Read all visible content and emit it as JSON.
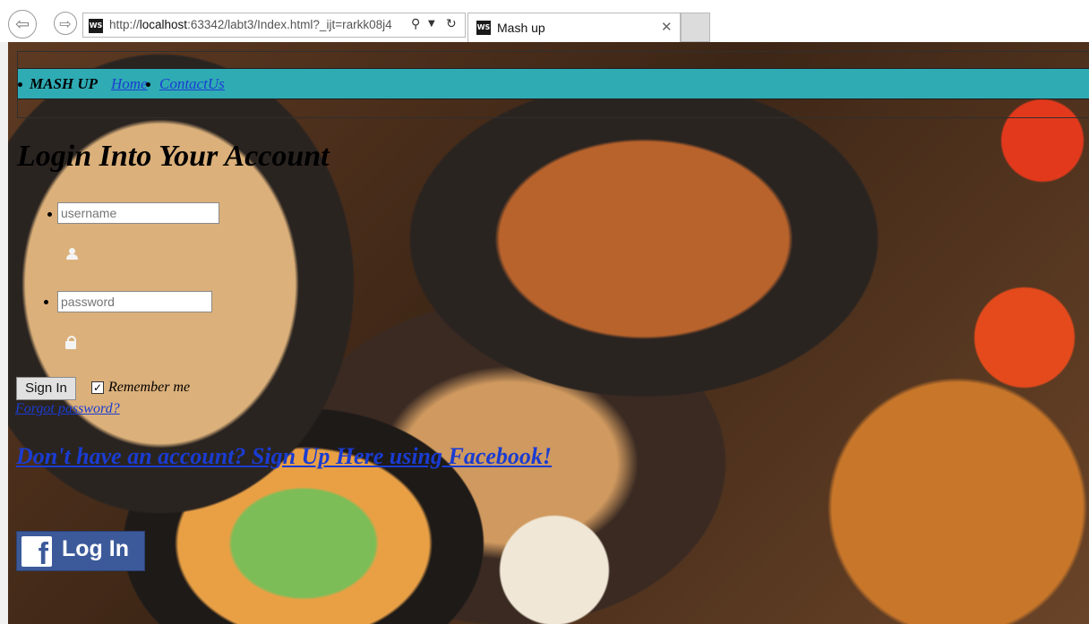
{
  "browser": {
    "url_prefix": "http://",
    "url_host": "localhost",
    "url_rest": ":63342/labt3/Index.html?_ijt=rarkk08j4",
    "tab_title": "Mash up",
    "favicon_text": "WS"
  },
  "nav": {
    "brand": "MASH UP",
    "links": [
      "Home",
      "ContactUs"
    ]
  },
  "login": {
    "heading": "Login Into Your Account",
    "username_placeholder": "username",
    "password_placeholder": "password",
    "signin_label": "Sign In",
    "remember_label": "Remember me",
    "remember_checked": true,
    "forgot_label": "Forgot password?"
  },
  "signup": {
    "label": "Don't have an account? Sign Up Here using Facebook!"
  },
  "facebook": {
    "label": "Log In",
    "color": "#3c5a9a"
  },
  "colors": {
    "navbar": "#2fabb4",
    "link": "#1a3cd1"
  }
}
